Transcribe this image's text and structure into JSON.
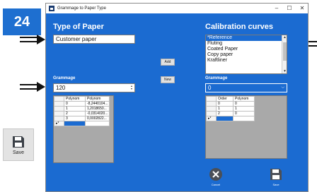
{
  "step_number": "24",
  "side_save": {
    "label": "Save",
    "icon": "save-icon"
  },
  "window": {
    "title": "Grammage to Paper Type",
    "controls": {
      "minimize": "–",
      "maximize": "☐",
      "close": "✕"
    }
  },
  "left": {
    "heading": "Type of Paper",
    "paper_name_value": "Customer paper",
    "grammage_label": "Grammage",
    "grammage_value": "120",
    "table": {
      "columns": [
        "Polynom",
        "Polynom"
      ],
      "rows": [
        [
          "0",
          "-8,2440104..."
        ],
        [
          "1",
          "1,2018650..."
        ],
        [
          "2",
          "-0,0314020..."
        ],
        [
          "3",
          "0,0002822..."
        ]
      ],
      "new_row_marker": "▸*"
    }
  },
  "middle": {
    "add_label": "Add",
    "new_label": "New"
  },
  "right": {
    "heading": "Calibration curves",
    "curves": [
      "*Reference",
      "Fluting",
      "Coated Paper",
      "Copy paper",
      "Kraftliner"
    ],
    "selected_curve": "*Reference",
    "grammage_label": "Grammage",
    "grammage_value": "0",
    "table": {
      "columns": [
        "Order",
        "Polynom"
      ],
      "rows": [
        [
          "0",
          "0"
        ],
        [
          "1",
          "1"
        ],
        [
          "2",
          "0"
        ]
      ],
      "new_row_marker": "▸*"
    },
    "cancel_label": "Cancel",
    "save_label": "Save"
  },
  "colors": {
    "window_blue": "#1b6bd1",
    "badge_blue": "#1e6fd0",
    "selection_blue": "#1b6bd1"
  }
}
